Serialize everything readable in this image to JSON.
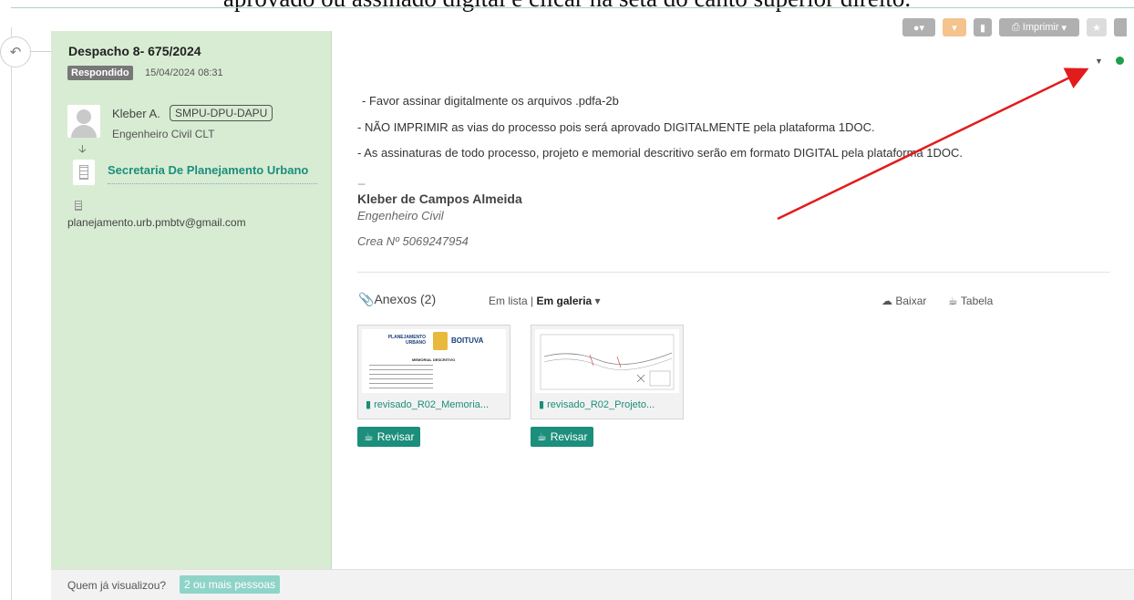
{
  "caption": "aprovado ou assinado digital e clicar na seta do canto superior direito.",
  "dispatch": {
    "title": "Despacho 8- 675/2024",
    "status": "Respondido",
    "datetime": "15/04/2024 08:31"
  },
  "sender": {
    "name": "Kleber A.",
    "sector_code": "SMPU-DPU-DAPU",
    "role": "Engenheiro Civil CLT",
    "sector_name": "Secretaria De Planejamento Urbano",
    "email": "planejamento.urb.pmbtv@gmail.com"
  },
  "toolbar": {
    "print_label": "Imprimir"
  },
  "message": {
    "lines": [
      " - Favor assinar digitalmente os arquivos .pdfa-2b",
      "- NÃO IMPRIMIR as vias do processo pois será aprovado DIGITALMENTE pela plataforma 1DOC.",
      "- As assinaturas de todo processo, projeto e memorial descritivo serão em formato DIGITAL pela plataforma 1DOC."
    ],
    "separator": "_",
    "signature_name": "Kleber de Campos Almeida",
    "signature_role": "Engenheiro Civil",
    "signature_crea": "Crea Nº 5069247954"
  },
  "attachments": {
    "title": "Anexos (2)",
    "view_list": "Em lista",
    "view_separator": "|",
    "view_gallery": "Em galeria",
    "download_label": "Baixar",
    "table_label": "Tabela",
    "files": [
      {
        "name": "revisado_R02_Memoria...",
        "review_label": "Revisar",
        "preview_logo_left": "PLANEJAMENTO URBANO",
        "preview_logo_right": "BOITUVA",
        "preview_heading": "MEMORIAL DESCRITIVO"
      },
      {
        "name": "revisado_R02_Projeto...",
        "review_label": "Revisar"
      }
    ]
  },
  "footer": {
    "question": "Quem já visualizou?",
    "viewers": "2 ou mais pessoas"
  },
  "colors": {
    "left_panel": "#d8ecd3",
    "accent": "#1b8e7c",
    "status_badge": "#777777",
    "annotation_arrow": "#e31b1b",
    "online_dot": "#1f9e4b"
  }
}
